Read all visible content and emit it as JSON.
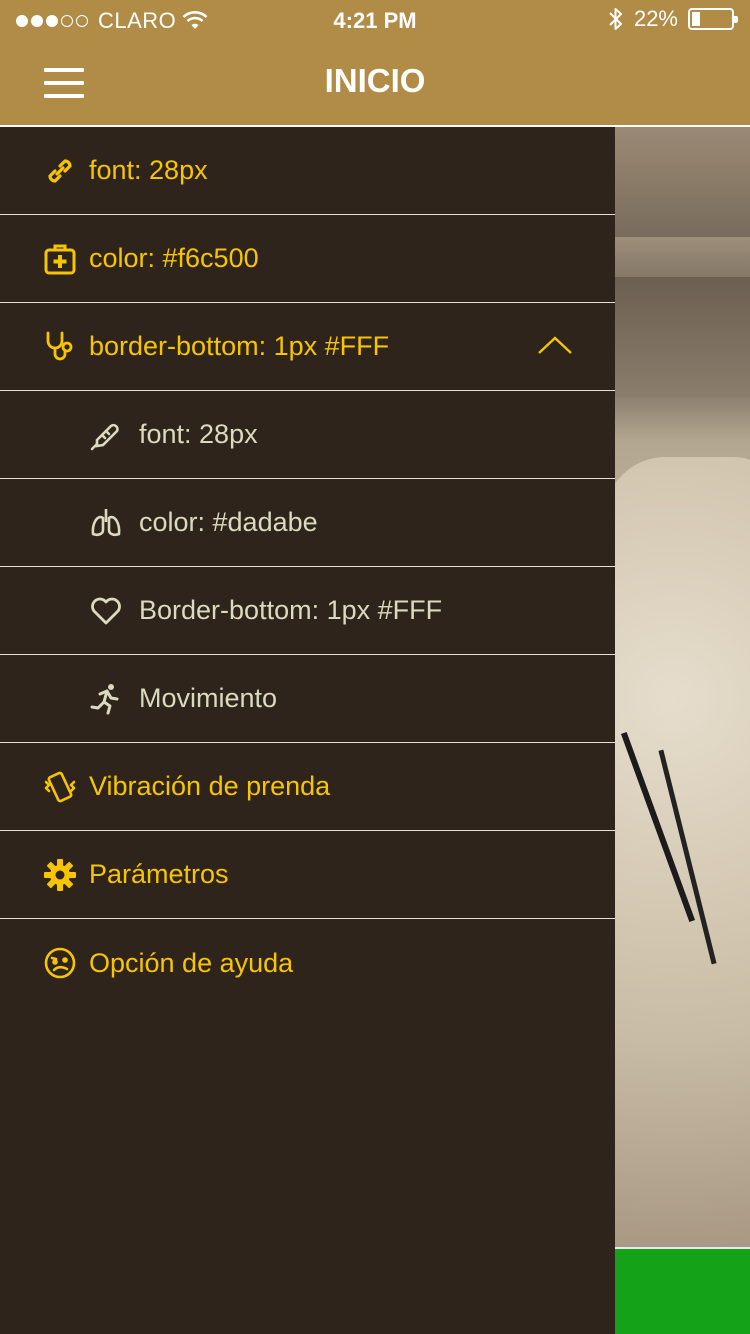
{
  "status_bar": {
    "carrier": "CLARO",
    "time": "4:21 PM",
    "battery_percent": "22%",
    "battery_level": 0.22,
    "signal_bars_filled": 3,
    "signal_bars_total": 5,
    "icons": [
      "wifi-icon",
      "bluetooth-icon",
      "battery-icon"
    ]
  },
  "header": {
    "title": "INICIO",
    "menu_icon": "hamburger-icon"
  },
  "colors": {
    "header_bg": "#b08c46",
    "menu_bg": "#2e241c",
    "primary_text": "#f6c500",
    "sub_text": "#dadabe",
    "divider": "#ffffff",
    "bottom_bar": "#14a218"
  },
  "menu": {
    "items": [
      {
        "label": "font: 28px",
        "icon": "link-icon",
        "level": 1
      },
      {
        "label": "color: #f6c500",
        "icon": "first-aid-kit-icon",
        "level": 1
      },
      {
        "label": "border-bottom: 1px #FFF",
        "icon": "stethoscope-icon",
        "level": 1,
        "expanded": true
      },
      {
        "label": "font: 28px",
        "icon": "thermometer-icon",
        "level": 2
      },
      {
        "label": "color: #dadabe",
        "icon": "lungs-icon",
        "level": 2
      },
      {
        "label": "Border-bottom: 1px #FFF",
        "icon": "heart-icon",
        "level": 2
      },
      {
        "label": "Movimiento",
        "icon": "running-person-icon",
        "level": 2
      },
      {
        "label": "Vibración de prenda",
        "icon": "vibrating-phone-icon",
        "level": 1
      },
      {
        "label": "Parámetros",
        "icon": "gear-icon",
        "level": 1
      },
      {
        "label": "Opción de ayuda",
        "icon": "confused-face-icon",
        "level": 1
      }
    ]
  }
}
